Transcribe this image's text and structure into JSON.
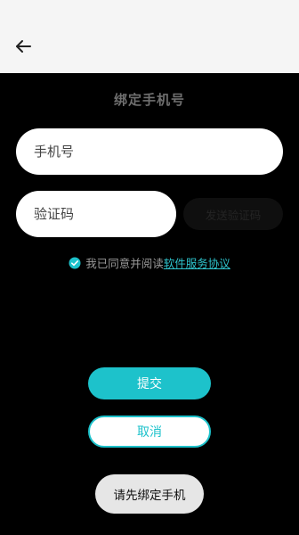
{
  "header": {
    "back_icon": "arrow-left-icon"
  },
  "page": {
    "title": "绑定手机号"
  },
  "form": {
    "phone_placeholder": "手机号",
    "phone_value": "",
    "code_placeholder": "验证码",
    "code_value": "",
    "send_code_label": "发送验证码"
  },
  "agreement": {
    "checked": true,
    "text": "我已同意并阅读",
    "link_text": "软件服务协议",
    "check_icon": "check-circle-icon"
  },
  "actions": {
    "submit_label": "提交",
    "cancel_label": "取消",
    "bind_phone_label": "请先绑定手机"
  },
  "colors": {
    "accent": "#1dc2cb",
    "background": "#000000",
    "header": "#f5f5f5"
  }
}
